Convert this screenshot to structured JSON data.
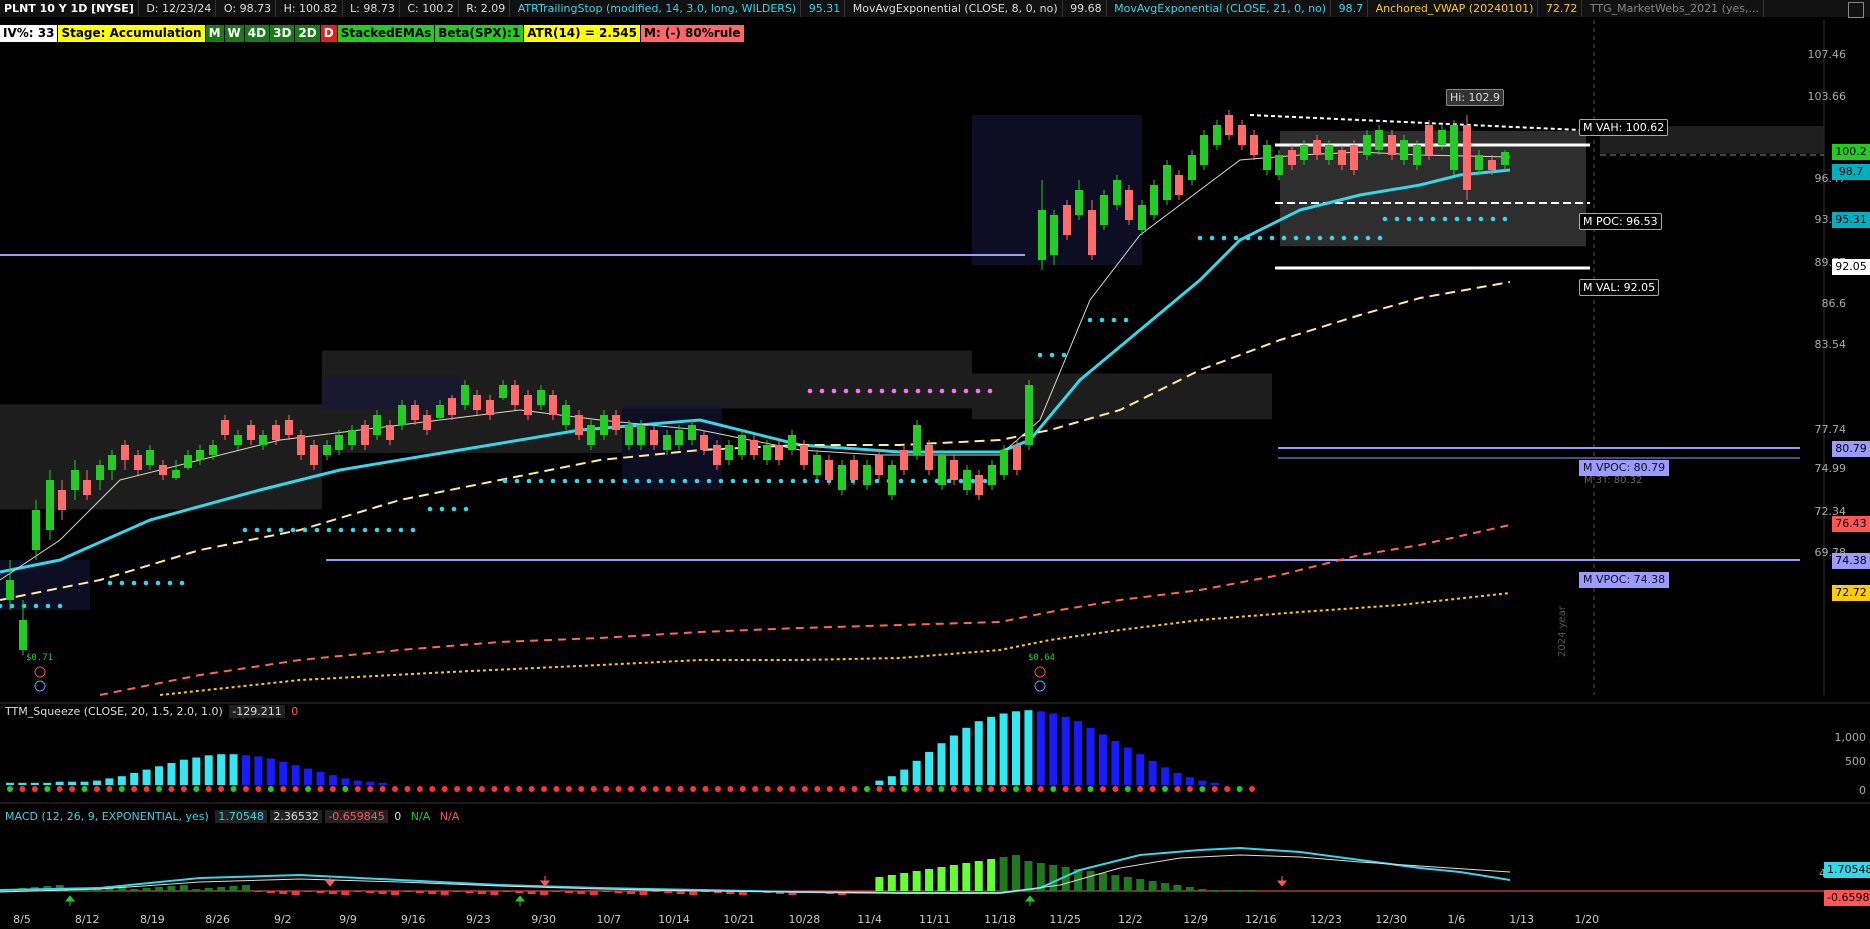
{
  "header": {
    "symbol": "PLNT 10 Y 1D [NYSE]",
    "date": "D: 12/23/24",
    "open": "O: 98.73",
    "high": "H: 100.82",
    "low": "L: 98.73",
    "close": "C: 100.2",
    "range": "R: 2.09",
    "atr_stop_label": "ATRTrailingStop (modified, 14, 3.0, long, WILDERS)",
    "atr_stop_value": "95.31",
    "ema8_label": "MovAvgExponential (CLOSE, 8, 0, no)",
    "ema8_value": "99.68",
    "ema21_label": "MovAvgExponential (CLOSE, 21, 0, no)",
    "ema21_value": "98.7",
    "vwap_label": "Anchored_VWAP (20240101)",
    "vwap_value": "72.72",
    "webs_label": "TTG_MarketWebs_2021 (yes,..."
  },
  "badges": [
    {
      "text": "IV%: 33",
      "bg": "#ffffff",
      "fg": "#000000"
    },
    {
      "text": "Stage: Accumulation",
      "bg": "#ffff00",
      "fg": "#000000"
    },
    {
      "text": "M",
      "bg": "#1a7a1a",
      "fg": "#ffffff"
    },
    {
      "text": "W",
      "bg": "#1a7a1a",
      "fg": "#ffffff"
    },
    {
      "text": "4D",
      "bg": "#1a7a1a",
      "fg": "#ffffff"
    },
    {
      "text": "3D",
      "bg": "#1a7a1a",
      "fg": "#ffffff"
    },
    {
      "text": "2D",
      "bg": "#1a7a1a",
      "fg": "#ffffff"
    },
    {
      "text": "D",
      "bg": "#e02020",
      "fg": "#ffffff"
    },
    {
      "text": "StackedEMAs",
      "bg": "#22cc22",
      "fg": "#000000"
    },
    {
      "text": "Beta(SPX):1",
      "bg": "#22cc22",
      "fg": "#000000"
    },
    {
      "text": "ATR(14) = 2.545",
      "bg": "#ffff00",
      "fg": "#000000"
    },
    {
      "text": "M: (-) 80%rule",
      "bg": "#ff6666",
      "fg": "#000000"
    }
  ],
  "price_axis": [
    "107.46",
    "103.66",
    "96.47",
    "93.06",
    "89.77",
    "86.6",
    "83.54",
    "77.74",
    "74.99",
    "72.34",
    "69.78"
  ],
  "price_tags": [
    {
      "text": "100.2",
      "bg": "#22cc22",
      "fg": "#000"
    },
    {
      "text": "98.7",
      "bg": "#00b0c0",
      "fg": "#000"
    },
    {
      "text": "95.31",
      "bg": "#00b0c0",
      "fg": "#000"
    },
    {
      "text": "92.05",
      "bg": "#ffffff",
      "fg": "#000"
    },
    {
      "text": "80.79",
      "bg": "#9a9aff",
      "fg": "#000"
    },
    {
      "text": "76.43",
      "bg": "#ff5555",
      "fg": "#000"
    },
    {
      "text": "74.38",
      "bg": "#9a9aff",
      "fg": "#000"
    },
    {
      "text": "72.72",
      "bg": "#ffcc00",
      "fg": "#000"
    }
  ],
  "annotations": {
    "hi": "Hi: 102.9",
    "vah": "M VAH: 100.62",
    "poc": "M POC: 96.53",
    "val": "M VAL: 92.05",
    "vpoc1": "M VPOC: 80.79",
    "vpoc2": "M VPOC: 74.38",
    "hidden_label": "M 3T: 80.32",
    "year": "2024 year",
    "div1": "$0.71",
    "div2": "$0.64"
  },
  "squeeze": {
    "label": "TTM_Squeeze (CLOSE, 20, 1.5, 2.0, 1.0)",
    "value": "-129.211",
    "flag": "0",
    "axis": [
      "1,000",
      "500",
      "0"
    ]
  },
  "macd": {
    "label": "MACD (12, 26, 9, EXPONENTIAL, yes)",
    "value1": "1.70548",
    "value2": "2.36532",
    "value3": "-0.659845",
    "zero": "0",
    "na1": "N/A",
    "na2": "N/A",
    "axis_top": "4",
    "tag_value": "1.70548",
    "tag_neg": "-0.6598"
  },
  "xaxis": [
    "8/5",
    "8/12",
    "8/19",
    "8/26",
    "9/2",
    "9/9",
    "9/16",
    "9/23",
    "9/30",
    "10/7",
    "10/14",
    "10/21",
    "10/28",
    "11/4",
    "11/11",
    "11/18",
    "11/25",
    "12/2",
    "12/9",
    "12/16",
    "12/23",
    "12/30",
    "1/6",
    "1/13",
    "1/20"
  ],
  "colors": {
    "up": "#22cc22",
    "down": "#ff6b6b",
    "ema21": "#33d7e8",
    "ema8": "#d8d8c8",
    "vwap": "#ffcc00",
    "ma200": "#ff6655",
    "vpoc": "#9a9aff"
  }
}
